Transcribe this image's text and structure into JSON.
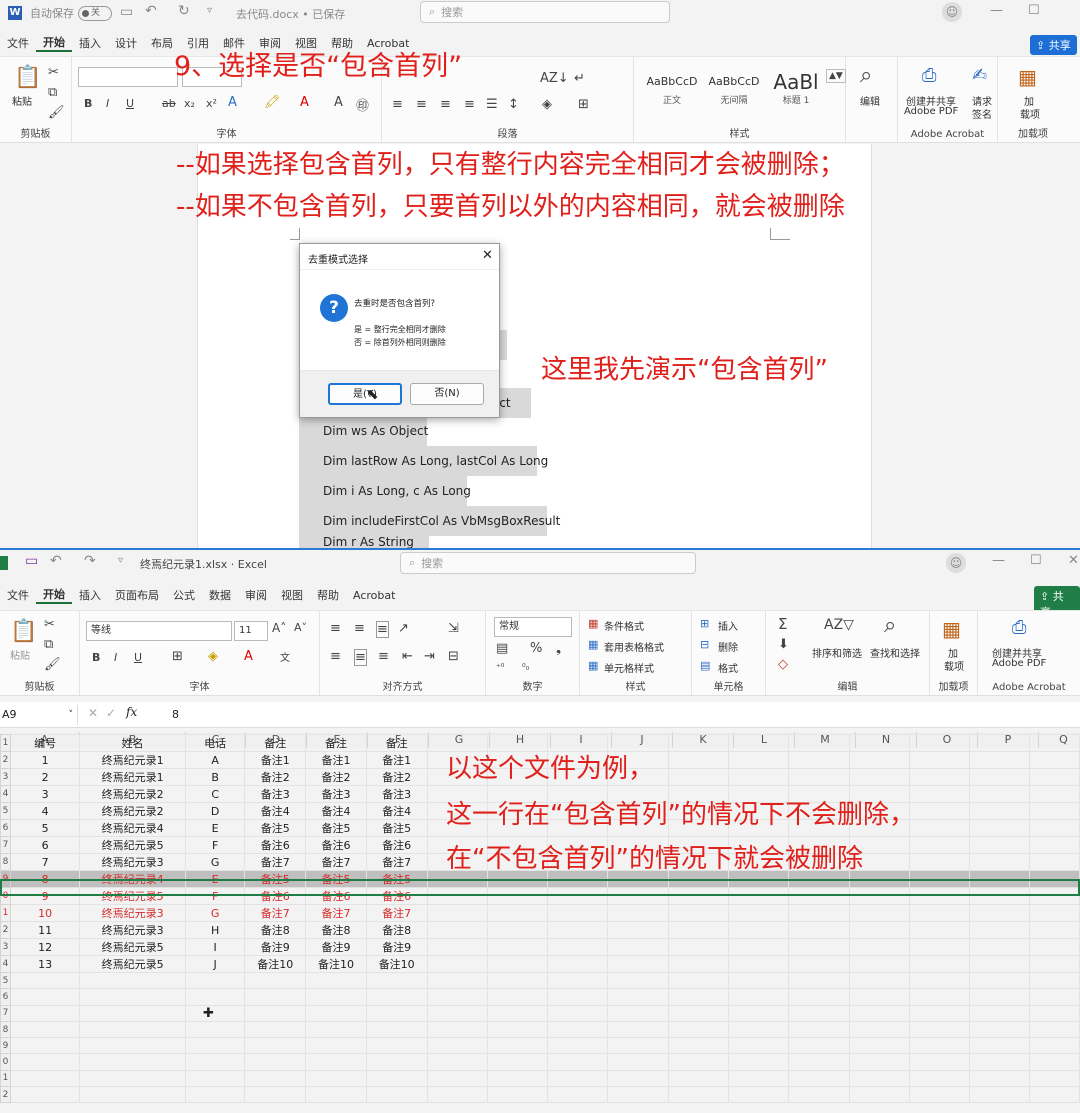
{
  "word": {
    "autosave_label": "自动保存",
    "autosave_state": "关",
    "doc_title": "去代码.docx • 已保存",
    "search_placeholder": "搜索",
    "menu": [
      "文件",
      "开始",
      "插入",
      "设计",
      "布局",
      "引用",
      "邮件",
      "审阅",
      "视图",
      "帮助",
      "Acrobat"
    ],
    "share_label": "共享",
    "ribbon": {
      "paste": "粘贴",
      "clipboard": "剪贴板",
      "font": "字体",
      "paragraph": "段落",
      "styles_group": "样式",
      "style_items": [
        {
          "preview": "AaBbCcD",
          "name": "正文"
        },
        {
          "preview": "AaBbCcD",
          "name": "无间隔"
        },
        {
          "preview": "AaBl",
          "name": "标题 1"
        }
      ],
      "edit": "编辑",
      "create_pdf": "创建并共享",
      "create_pdf2": "Adobe PDF",
      "request_sign": "请求",
      "request_sign2": "签名",
      "adobe_group": "Adobe Acrobat",
      "addin": "加",
      "addin2": "载项",
      "addin_group": "加载项"
    },
    "dialog": {
      "title": "去重模式选择",
      "question": "去重时是否包含首列?",
      "line1": "是 = 整行完全相同才删除",
      "line2": "否 = 除首列外相同则删除",
      "yes": "是(Y)",
      "no": "否(N)"
    },
    "code_lines": [
      "bject",
      "Dim ws As Object",
      "Dim lastRow As Long, lastCol As Long",
      "Dim i As Long, c As Long",
      "Dim includeFirstCol As VbMsgBoxResult",
      "Dim r As String"
    ]
  },
  "annotations": {
    "step_title": "9、选择是否“包含首列”",
    "note1": "--如果选择包含首列，只有整行内容完全相同才会被删除；",
    "note2": "--如果不包含首列，只要首列以外的内容相同，就会被删除",
    "demo_note": "这里我先演示“包含首列”",
    "excel_note1": "以这个文件为例，",
    "excel_note2": "这一行在“包含首列”的情况下不会删除，",
    "excel_note3": "在“不包含首列”的情况下就会被删除"
  },
  "excel": {
    "file_title": "终焉纪元录1.xlsx · Excel",
    "search_placeholder": "搜索",
    "menu": [
      "文件",
      "开始",
      "插入",
      "页面布局",
      "公式",
      "数据",
      "审阅",
      "视图",
      "帮助",
      "Acrobat"
    ],
    "share_label": "共享",
    "ribbon": {
      "paste": "粘贴",
      "clipboard": "剪贴板",
      "font_name": "等线",
      "font_size": "11",
      "font": "字体",
      "align": "对齐方式",
      "number_format": "常规",
      "number": "数字",
      "cond_format": "条件格式",
      "table_format": "套用表格格式",
      "cell_style": "单元格样式",
      "styles": "样式",
      "insert": "插入",
      "delete": "删除",
      "format": "格式",
      "cells": "单元格",
      "sort_filter": "排序和筛选",
      "find_select": "查找和选择",
      "editing": "编辑",
      "addin": "加",
      "addin2": "载项",
      "addin_group": "加载项",
      "create_pdf": "创建并共享",
      "create_pdf2": "Adobe PDF",
      "adobe_group": "Adobe Acrobat"
    },
    "name_box": "A9",
    "formula_value": "8",
    "columns": [
      "A",
      "B",
      "C",
      "D",
      "E",
      "F",
      "G",
      "H",
      "I",
      "J",
      "K",
      "L",
      "M",
      "N",
      "O",
      "P",
      "Q"
    ],
    "header_row": [
      "编号",
      "姓名",
      "电话",
      "备注",
      "备注",
      "备注"
    ],
    "rows": [
      [
        "1",
        "终焉纪元录1",
        "A",
        "备注1",
        "备注1",
        "备注1"
      ],
      [
        "2",
        "终焉纪元录1",
        "B",
        "备注2",
        "备注2",
        "备注2"
      ],
      [
        "3",
        "终焉纪元录2",
        "C",
        "备注3",
        "备注3",
        "备注3"
      ],
      [
        "4",
        "终焉纪元录2",
        "D",
        "备注4",
        "备注4",
        "备注4"
      ],
      [
        "5",
        "终焉纪元录4",
        "E",
        "备注5",
        "备注5",
        "备注5"
      ],
      [
        "6",
        "终焉纪元录5",
        "F",
        "备注6",
        "备注6",
        "备注6"
      ],
      [
        "7",
        "终焉纪元录3",
        "G",
        "备注7",
        "备注7",
        "备注7"
      ],
      [
        "8",
        "终焉纪元录4",
        "E",
        "备注5",
        "备注5",
        "备注5"
      ],
      [
        "9",
        "终焉纪元录5",
        "F",
        "备注6",
        "备注6",
        "备注6"
      ],
      [
        "10",
        "终焉纪元录3",
        "G",
        "备注7",
        "备注7",
        "备注7"
      ],
      [
        "11",
        "终焉纪元录3",
        "H",
        "备注8",
        "备注8",
        "备注8"
      ],
      [
        "12",
        "终焉纪元录5",
        "I",
        "备注9",
        "备注9",
        "备注9"
      ],
      [
        "13",
        "终焉纪元录5",
        "J",
        "备注10",
        "备注10",
        "备注10"
      ]
    ],
    "row_numbers": [
      "",
      "1",
      "2",
      "3",
      "4",
      "5",
      "6",
      "7",
      "8",
      "9",
      "0",
      "1",
      "2",
      "3",
      "4",
      "5",
      "6",
      "7",
      "8",
      "9",
      "0",
      "1",
      "2"
    ]
  }
}
